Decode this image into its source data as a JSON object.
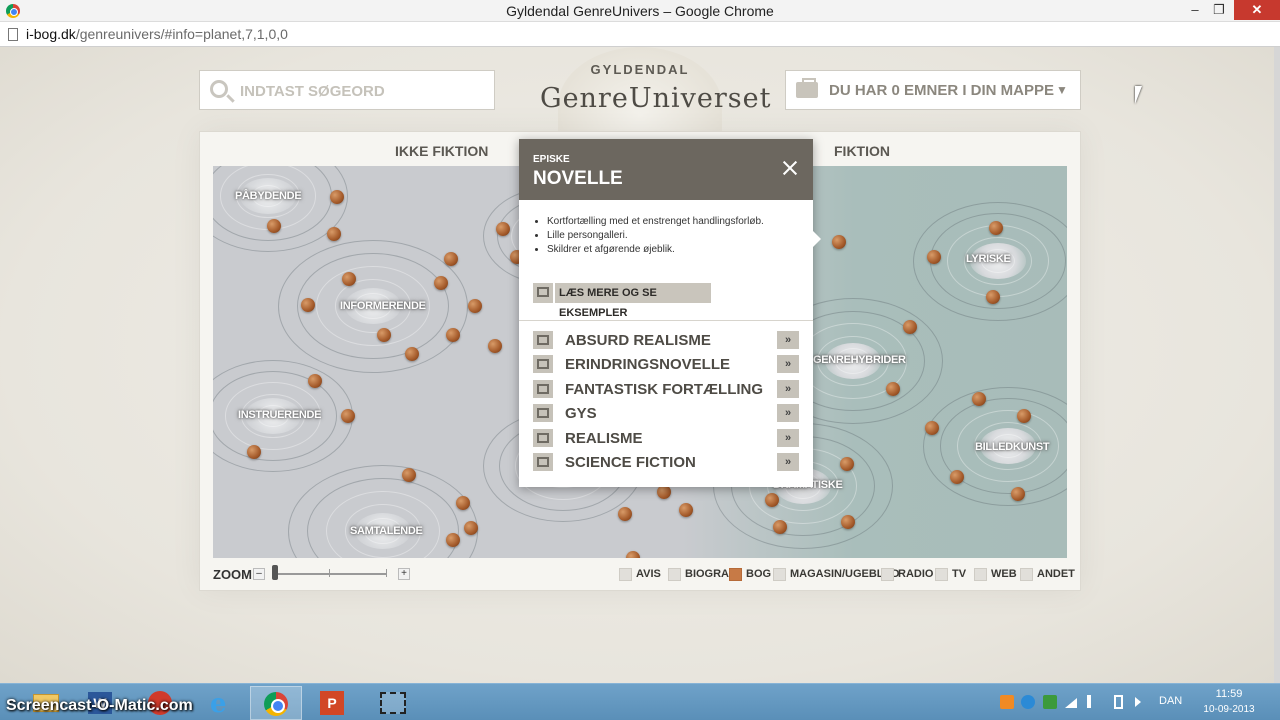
{
  "window": {
    "title": "Gyldendal GenreUnivers – Google Chrome",
    "minimize_glyph": "–",
    "maximize_glyph": "❐",
    "close_glyph": "✕"
  },
  "address_bar": {
    "host": "i-bog.dk",
    "path": "/genreunivers/#info=planet,7,1,0,0"
  },
  "header": {
    "search_placeholder": "INDTAST SØGEORD",
    "logo_brand": "GYLDENDAL",
    "logo_product": "GenreUniverset",
    "folder_label": "DU HAR 0 EMNER I DIN MAPPE",
    "folder_chevron": "▼"
  },
  "board": {
    "category_left": "IKKE FIKTION",
    "category_right": "FIKTION",
    "galaxies": [
      "PÅBYDENDE",
      "INFORMERENDE",
      "INSTRUERENDE",
      "SAMTALENDE",
      "LYRISKE",
      "GENREHYBRIDER",
      "BILLEDKUNST",
      "DRAMATISKE"
    ]
  },
  "popup": {
    "kicker": "EPISKE",
    "title": "NOVELLE",
    "bullets": [
      "Kortfortælling med et enstrenget handlingsforløb.",
      "Lille persongalleri.",
      "Skildrer et afgørende øjeblik."
    ],
    "more_label": "LÆS MERE OG SE EKSEMPLER",
    "items": [
      {
        "label": "ABSURD REALISME",
        "arrow": "»"
      },
      {
        "label": "ERINDRINGSNOVELLE",
        "arrow": "»"
      },
      {
        "label": "FANTASTISK FORTÆLLING",
        "arrow": "»"
      },
      {
        "label": "GYS",
        "arrow": "»"
      },
      {
        "label": "REALISME",
        "arrow": "»"
      },
      {
        "label": "SCIENCE FICTION",
        "arrow": "»"
      }
    ]
  },
  "zoom": {
    "label": "ZOOM",
    "minus": "–",
    "plus": "+"
  },
  "filters": [
    {
      "label": "AVIS",
      "checked": false
    },
    {
      "label": "BIOGRAF",
      "checked": false
    },
    {
      "label": "BOG",
      "checked": true
    },
    {
      "label": "MAGASIN/UGEBLAD",
      "checked": false
    },
    {
      "label": "RADIO",
      "checked": false
    },
    {
      "label": "TV",
      "checked": false
    },
    {
      "label": "WEB",
      "checked": false
    },
    {
      "label": "ANDET",
      "checked": false
    }
  ],
  "taskbar": {
    "watermark": "Screencast-O-Matic.com",
    "word_glyph": "W",
    "ie_glyph": "e",
    "ppt_glyph": "P",
    "language": "DAN",
    "time": "11:59",
    "date": "10-09-2013"
  },
  "colors": {
    "accent_orange": "#c77a46",
    "popup_header": "#6c675f",
    "taskbar": "#5a8fb8"
  }
}
